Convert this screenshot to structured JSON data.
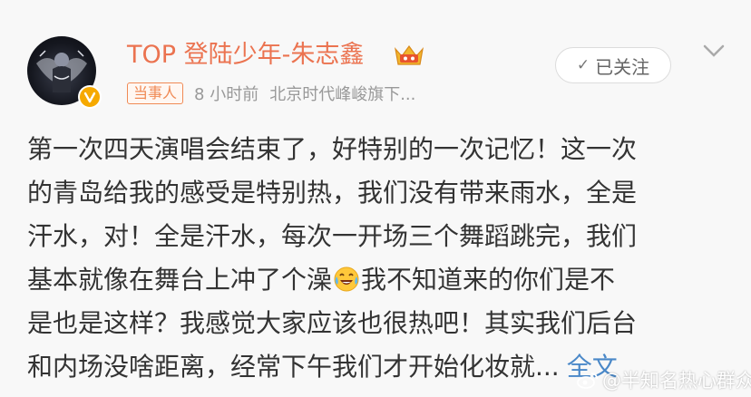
{
  "post": {
    "username": "TOP 登陆少年-朱志鑫",
    "role_tag": "当事人",
    "time": "8 小时前",
    "source": "北京时代峰峻旗下...",
    "follow_label": "已关注",
    "content_lines": [
      "第一次四天演唱会结束了，好特别的一次记忆！这一次",
      "的青岛给我的感受是特别热，我们没有带来雨水，全是",
      "汗水，对！全是汗水，每次一开场三个舞蹈跳完，我们"
    ],
    "line4_before_emoji": "基本就像在舞台上冲了个澡",
    "line4_after_emoji": "我不知道来的你们是不",
    "line5": "是也是这样？我感觉大家应该也很热吧！其实我们后台",
    "line6": "和内场没啥距离，经常下午我们才开始化妆就...",
    "full_text_link": "全文",
    "emoji_name": "laughing-tears-emoji"
  },
  "watermark": {
    "text": "@半知名热心群众"
  },
  "colors": {
    "username": "#eb7350",
    "link": "#4a88c8",
    "tag": "#f08a55",
    "verified": "#f6a900"
  }
}
